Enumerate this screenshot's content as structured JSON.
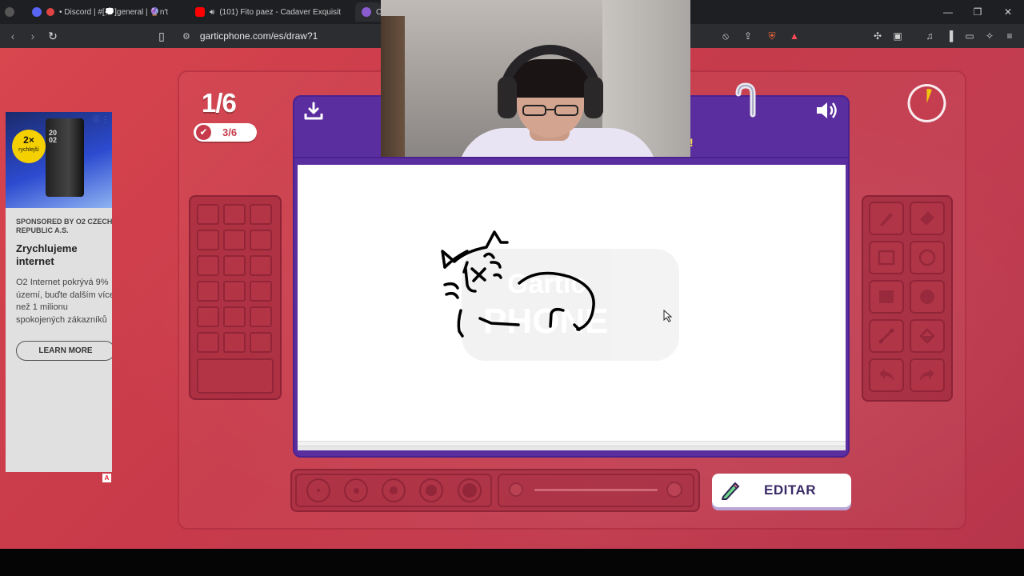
{
  "browser": {
    "tabs": [
      {
        "label": "• Discord | #[💭]general | 🔮n't",
        "active": false
      },
      {
        "label": "(101) Fito paez - Cadaver Exquisit",
        "active": false
      },
      {
        "label": "C",
        "active": true
      }
    ],
    "url": "garticphone.com/es/draw?1"
  },
  "game": {
    "round": "1/6",
    "players_done": "3/6",
    "action_button": "EDITAR",
    "accent": "#5b2ea0",
    "background": "#c83a4a"
  },
  "ad": {
    "badge_big": "2×",
    "badge_small": "rychlejší",
    "router_label": "20\n02",
    "sponsor": "SPONSORED BY O2 CZECH REPUBLIC A.S.",
    "title": "Zrychlujeme internet",
    "body": "O2 Internet pokrývá 9% území, buďte dalším více než 1 milionu spokojených zákazníků",
    "cta": "LEARN MORE",
    "info_icon": "ⓘ ⋮",
    "adchoices": "A"
  },
  "icons": {
    "download": "download-icon",
    "volume": "volume-icon",
    "timer": "timer-icon"
  }
}
